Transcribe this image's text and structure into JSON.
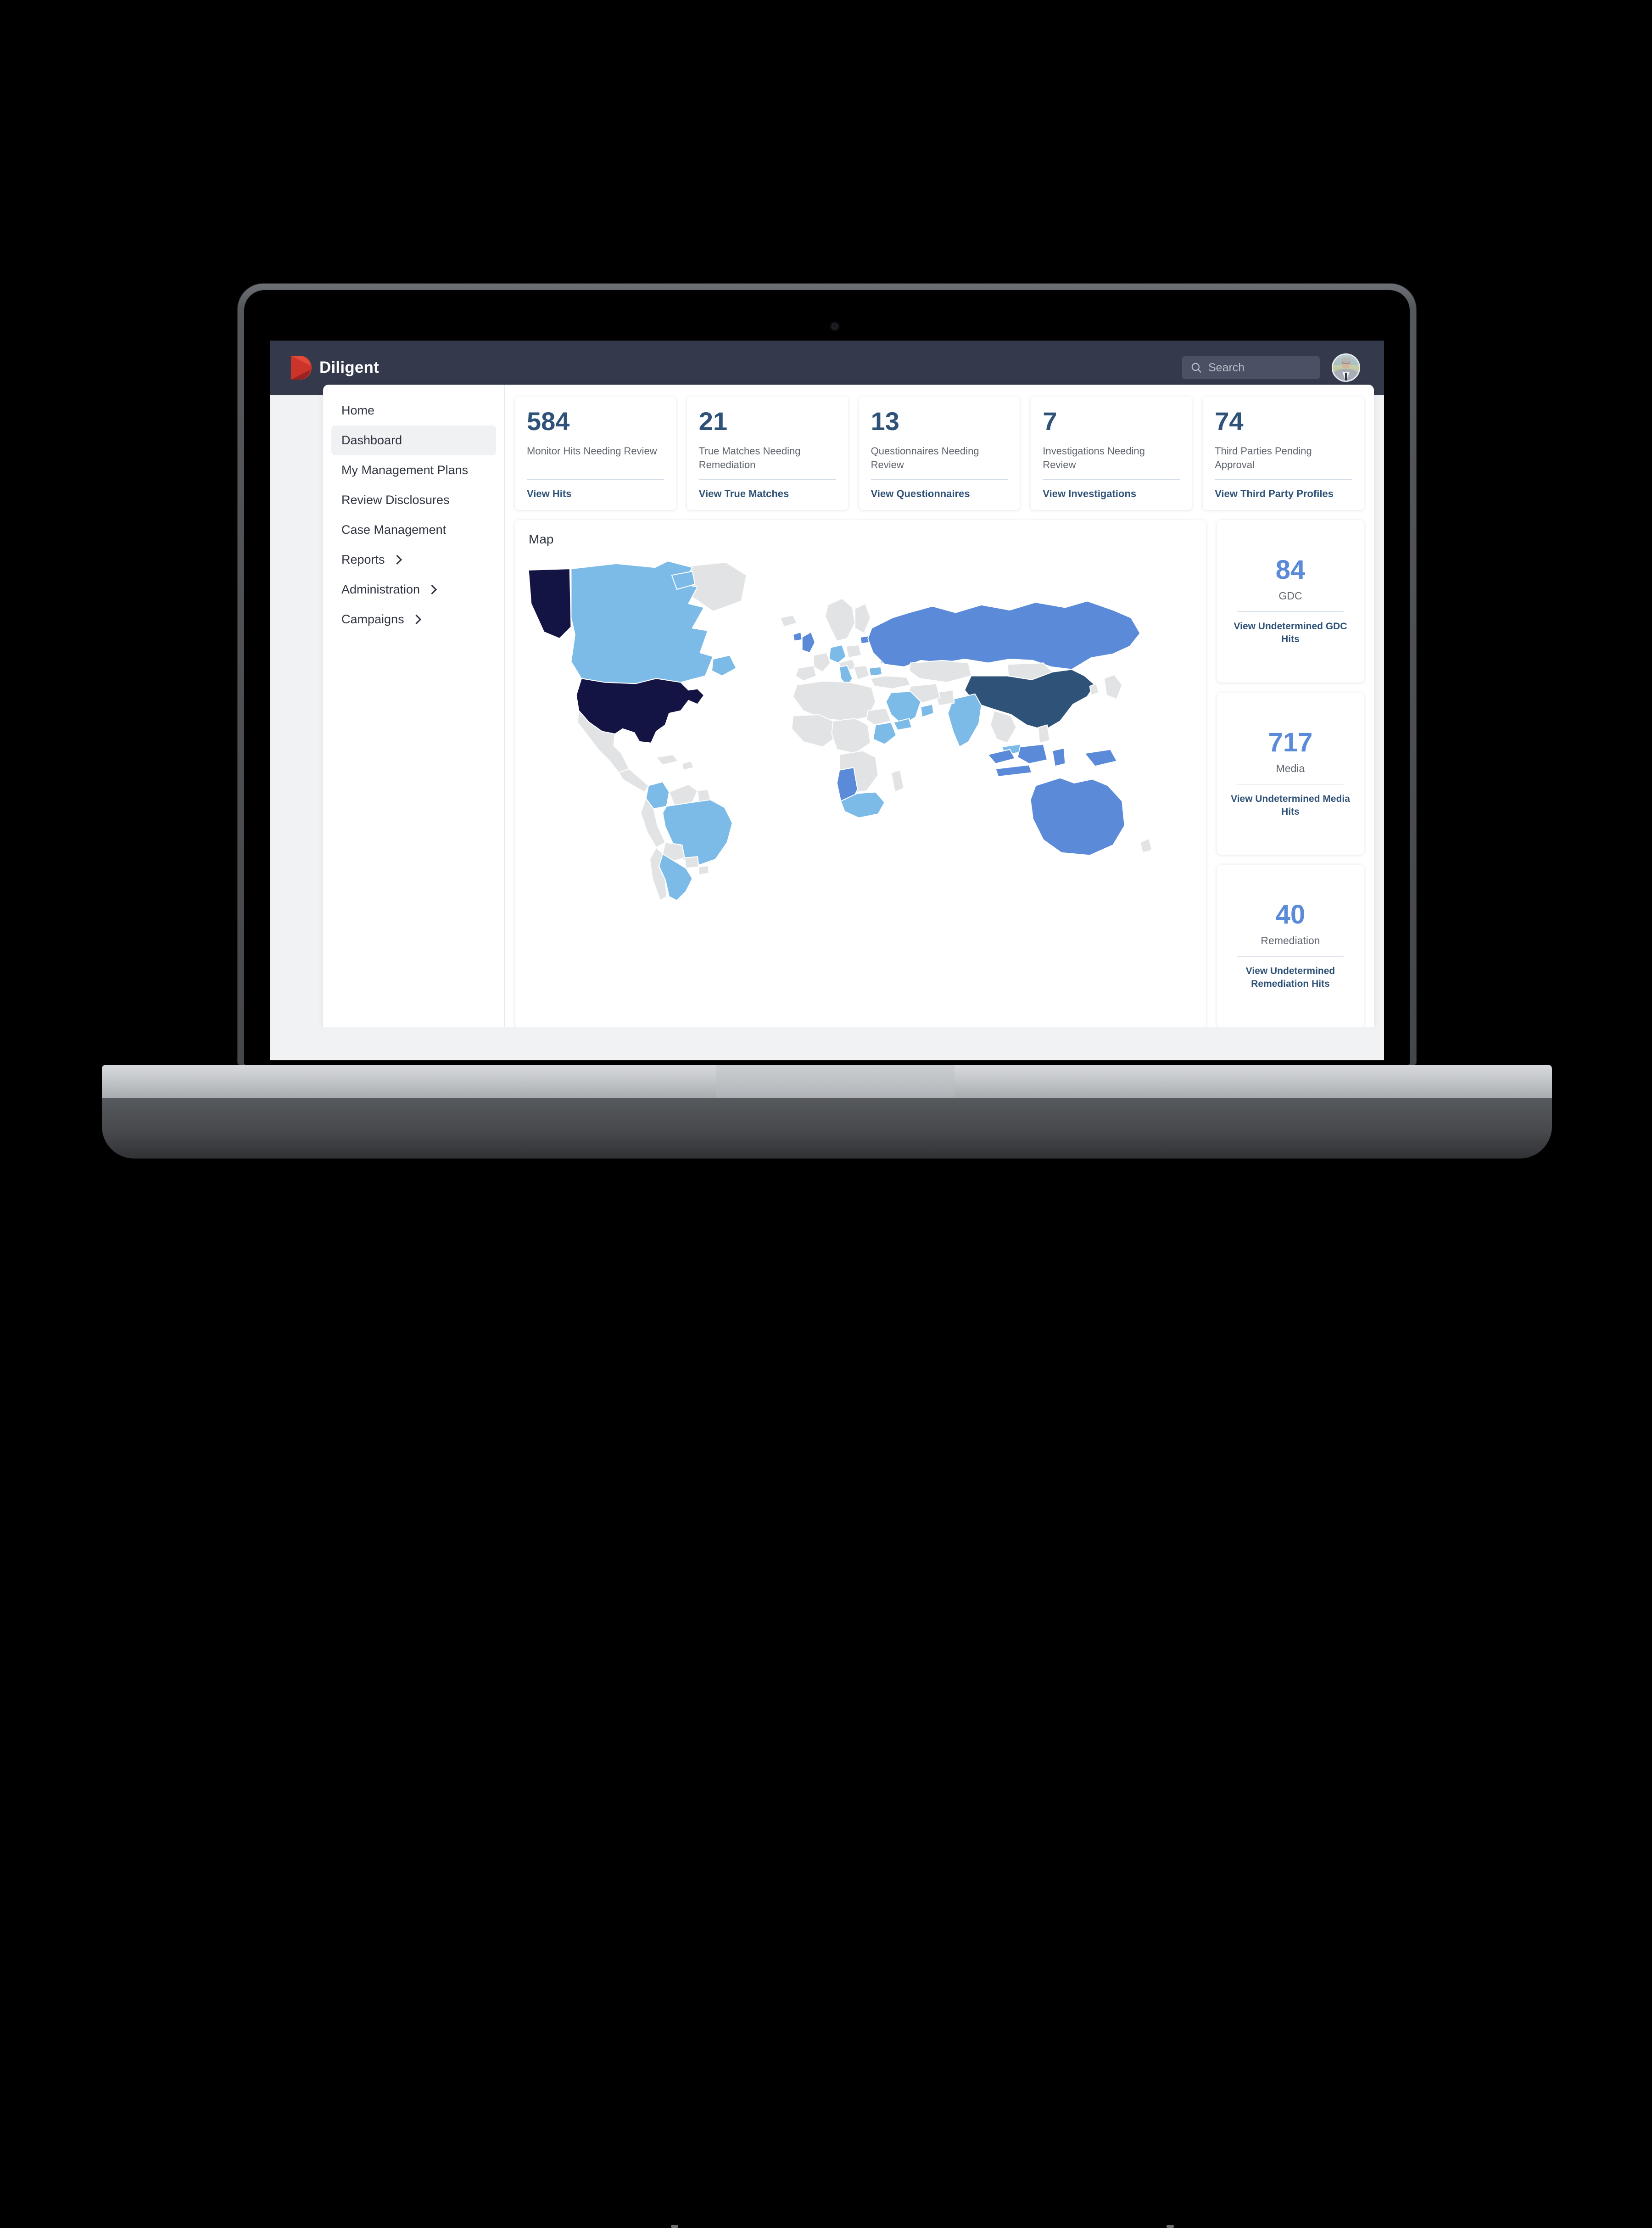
{
  "brand": {
    "name": "Diligent",
    "logo_icon": "diligent-d-logo",
    "accent_color": "#d6382c"
  },
  "header": {
    "background_color": "#343a4c",
    "search": {
      "placeholder": "Search",
      "value": "",
      "icon": "search-icon"
    },
    "avatar_alt": "user-avatar"
  },
  "sidebar": {
    "items": [
      {
        "label": "Home",
        "active": false,
        "has_chevron": false
      },
      {
        "label": "Dashboard",
        "active": true,
        "has_chevron": false
      },
      {
        "label": "My Management Plans",
        "active": false,
        "has_chevron": false
      },
      {
        "label": "Review Disclosures",
        "active": false,
        "has_chevron": false
      },
      {
        "label": "Case Management",
        "active": false,
        "has_chevron": false
      },
      {
        "label": "Reports",
        "active": false,
        "has_chevron": true
      },
      {
        "label": "Administration",
        "active": false,
        "has_chevron": true
      },
      {
        "label": "Campaigns",
        "active": false,
        "has_chevron": true
      }
    ]
  },
  "stats": [
    {
      "value": "584",
      "label": "Monitor Hits Needing Review",
      "link": "View Hits"
    },
    {
      "value": "21",
      "label": "True Matches Needing Remediation",
      "link": "View True Matches"
    },
    {
      "value": "13",
      "label": "Questionnaires Needing Review",
      "link": "View Questionnaires"
    },
    {
      "value": "7",
      "label": "Investigations Needing Review",
      "link": "View Investigations"
    },
    {
      "value": "74",
      "label": "Third Parties Pending Approval",
      "link": "View Third Party Profiles"
    }
  ],
  "map": {
    "title": "Map"
  },
  "side_cards": [
    {
      "value": "84",
      "label": "GDC",
      "link": "View Undetermined GDC Hits"
    },
    {
      "value": "717",
      "label": "Media",
      "link": "View Undetermined Media Hits"
    },
    {
      "value": "40",
      "label": "Remediation",
      "link": "View Undetermined Remediation Hits"
    }
  ],
  "chart_data": {
    "type": "heatmap",
    "title": "Map",
    "description": "World choropleth of third-party risk coverage by country",
    "legend_position": "none",
    "color_scale": [
      {
        "name": "none",
        "hex": "#e2e3e5"
      },
      {
        "name": "low",
        "hex": "#7cbbe8"
      },
      {
        "name": "medium",
        "hex": "#5a8ad8"
      },
      {
        "name": "high",
        "hex": "#2f5278"
      },
      {
        "name": "highest",
        "hex": "#141444"
      }
    ],
    "countries": [
      {
        "name": "United States",
        "level": "highest",
        "hex": "#141444"
      },
      {
        "name": "Alaska",
        "level": "highest",
        "hex": "#141444"
      },
      {
        "name": "Canada",
        "level": "low",
        "hex": "#7cbbe8"
      },
      {
        "name": "Mexico",
        "level": "none",
        "hex": "#e2e3e5"
      },
      {
        "name": "Colombia",
        "level": "low",
        "hex": "#7cbbe8"
      },
      {
        "name": "Venezuela",
        "level": "none",
        "hex": "#e2e3e5"
      },
      {
        "name": "Brazil",
        "level": "low",
        "hex": "#7cbbe8"
      },
      {
        "name": "Argentina",
        "level": "low",
        "hex": "#7cbbe8"
      },
      {
        "name": "Peru",
        "level": "none",
        "hex": "#e2e3e5"
      },
      {
        "name": "Chile",
        "level": "none",
        "hex": "#e2e3e5"
      },
      {
        "name": "United Kingdom",
        "level": "medium",
        "hex": "#5a8ad8"
      },
      {
        "name": "Germany",
        "level": "low",
        "hex": "#7cbbe8"
      },
      {
        "name": "Italy",
        "level": "low",
        "hex": "#7cbbe8"
      },
      {
        "name": "Bulgaria",
        "level": "low",
        "hex": "#7cbbe8"
      },
      {
        "name": "Lithuania",
        "level": "medium",
        "hex": "#5a8ad8"
      },
      {
        "name": "France",
        "level": "none",
        "hex": "#e2e3e5"
      },
      {
        "name": "Spain",
        "level": "none",
        "hex": "#e2e3e5"
      },
      {
        "name": "Norway",
        "level": "none",
        "hex": "#e2e3e5"
      },
      {
        "name": "Sweden",
        "level": "none",
        "hex": "#e2e3e5"
      },
      {
        "name": "Russia",
        "level": "medium",
        "hex": "#5a8ad8"
      },
      {
        "name": "China",
        "level": "high",
        "hex": "#2f5278"
      },
      {
        "name": "India",
        "level": "low",
        "hex": "#7cbbe8"
      },
      {
        "name": "Saudi Arabia",
        "level": "low",
        "hex": "#7cbbe8"
      },
      {
        "name": "Kazakhstan",
        "level": "none",
        "hex": "#e2e3e5"
      },
      {
        "name": "Mongolia",
        "level": "none",
        "hex": "#e2e3e5"
      },
      {
        "name": "Indonesia",
        "level": "medium",
        "hex": "#5a8ad8"
      },
      {
        "name": "Malaysia",
        "level": "low",
        "hex": "#7cbbe8"
      },
      {
        "name": "Papua New Guinea",
        "level": "medium",
        "hex": "#5a8ad8"
      },
      {
        "name": "Australia",
        "level": "medium",
        "hex": "#5a8ad8"
      },
      {
        "name": "South Africa",
        "level": "low",
        "hex": "#7cbbe8"
      },
      {
        "name": "Namibia",
        "level": "medium",
        "hex": "#5a8ad8"
      },
      {
        "name": "Kenya",
        "level": "low",
        "hex": "#7cbbe8"
      },
      {
        "name": "Greenland",
        "level": "none",
        "hex": "#e2e3e5"
      }
    ]
  }
}
